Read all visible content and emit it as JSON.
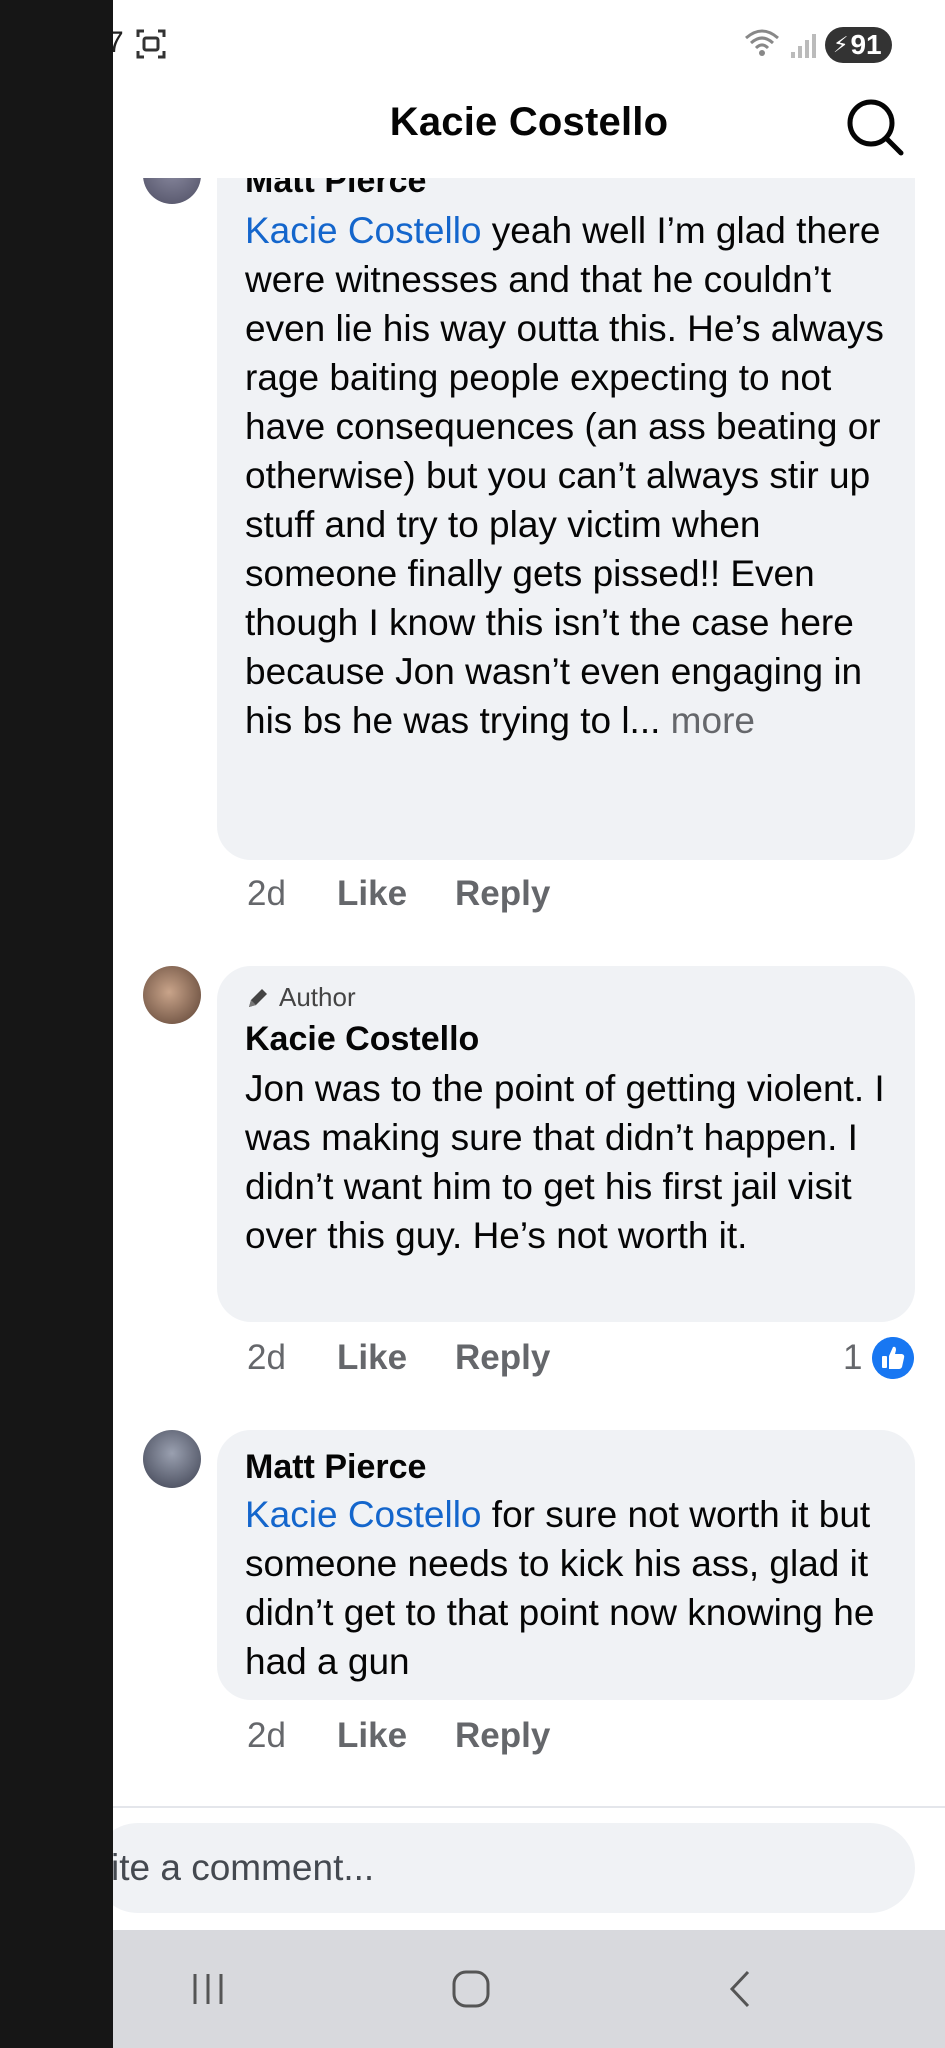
{
  "status_bar": {
    "time_fragment": "7",
    "battery_level": "91"
  },
  "header": {
    "title": "Kacie Costello"
  },
  "comments": [
    {
      "author": "Matt Pierce",
      "mention": "Kacie Costello",
      "text": " yeah well I’m glad there were witnesses and that he couldn’t even lie his way outta this. He’s always rage baiting people expecting to not have consequences (an ass beating or otherwise) but you can’t always stir up stuff and try to play victim when someone finally gets pissed!! Even though I know this isn’t the case here because Jon wasn’t even engaging in his bs he was trying to l...",
      "more_label": " more",
      "time": "2d",
      "like_label": "Like",
      "reply_label": "Reply"
    },
    {
      "badge": "Author",
      "author": "Kacie Costello",
      "text": "Jon was to the point of getting violent. I was making sure that didn’t happen. I didn’t want him to get his first jail visit over this guy. He’s not worth it.",
      "time": "2d",
      "like_label": "Like",
      "reply_label": "Reply",
      "reaction_count": "1"
    },
    {
      "author": "Matt Pierce",
      "mention": "Kacie Costello",
      "text": " for sure not worth it but someone needs to kick his ass, glad it didn’t get to that point now knowing he had a gun",
      "time": "2d",
      "like_label": "Like",
      "reply_label": "Reply"
    }
  ],
  "composer": {
    "placeholder": "ite a comment..."
  },
  "icons": {
    "search": "search-icon",
    "reaction": "like-reaction-icon",
    "author_badge": "pencil-icon",
    "nav": [
      "recents-icon",
      "home-icon",
      "back-icon"
    ]
  },
  "colors": {
    "mention": "#1466cc",
    "bubble": "#f0f2f5",
    "secondary_text": "#65676b",
    "like_blue": "#1877f2",
    "nav_bar": "#d8d9dd"
  }
}
